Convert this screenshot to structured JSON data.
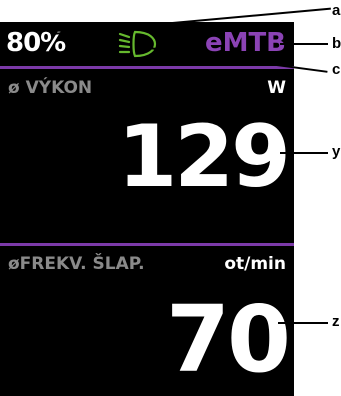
{
  "status_bar": {
    "battery": "80%",
    "light_icon": "headlight-icon",
    "mode": "eMTB"
  },
  "panels": [
    {
      "title": "ø VÝKON",
      "unit": "W",
      "value": "129"
    },
    {
      "title": "øFREKV. ŠLAP.",
      "unit": "ot/min",
      "value": "70"
    }
  ],
  "callouts": {
    "a": "a",
    "b": "b",
    "c": "c",
    "y": "y",
    "z": "z"
  },
  "colors": {
    "screen_bg": "#000000",
    "accent": "#7c3aa8",
    "mode_text": "#8b43b5",
    "light_icon": "#66b92e",
    "label_grey": "#8a8a8a",
    "value_text": "#ffffff"
  }
}
